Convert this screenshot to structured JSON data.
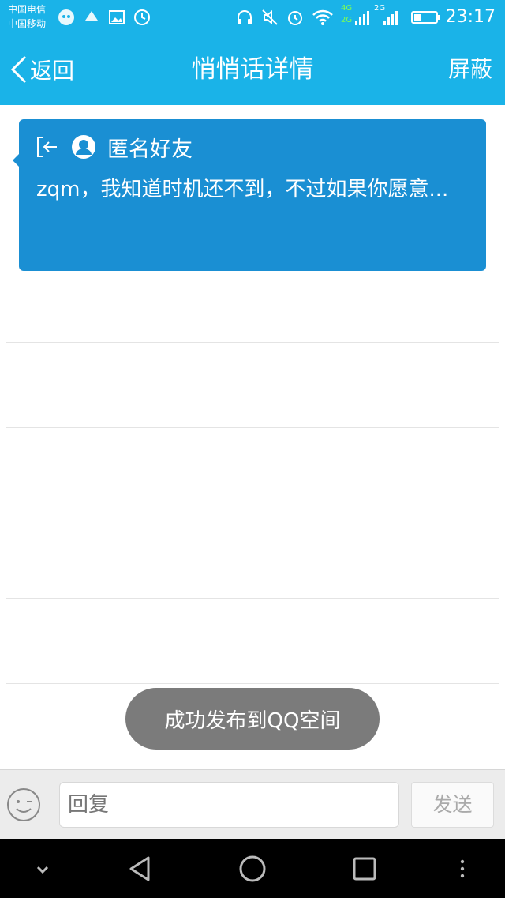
{
  "status_bar": {
    "carrier_1": "中国电信",
    "carrier_2": "中国移动",
    "network_1": "4G",
    "network_2": "2G",
    "network_3": "2G",
    "time": "23:17"
  },
  "nav": {
    "back_label": "返回",
    "title": "悄悄话详情",
    "block_label": "屏蔽"
  },
  "message": {
    "sender": "匿名好友",
    "text": "zqm，我知道时机还不到，不过如果你愿意..."
  },
  "toast": {
    "text": "成功发布到QQ空间"
  },
  "reply": {
    "placeholder": "回复",
    "send_label": "发送"
  },
  "colors": {
    "header": "#1ab3e8",
    "card": "#1a8fd3",
    "toast": "#7b7b7b"
  }
}
